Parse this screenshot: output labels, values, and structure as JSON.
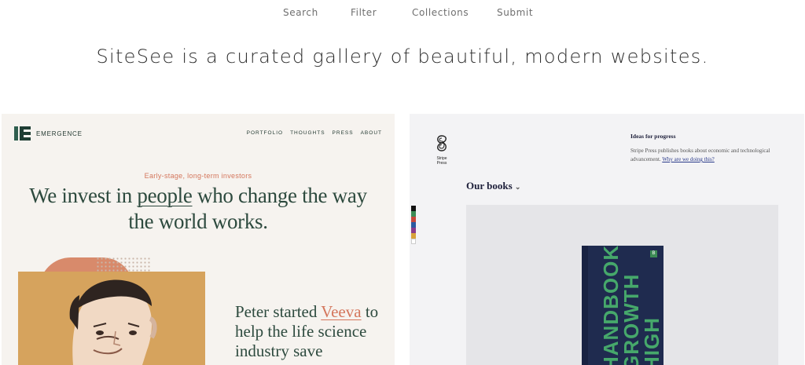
{
  "nav": {
    "items": [
      "Search",
      "Filter",
      "Collections",
      "Submit"
    ]
  },
  "tagline": "SiteSee is a curated gallery of beautiful, modern websites.",
  "emergence": {
    "logo_text": "EMERGENCE",
    "nav": [
      "PORTFOLIO",
      "THOUGHTS",
      "PRESS",
      "ABOUT"
    ],
    "eyebrow": "Early-stage, long-term investors",
    "headline_pre": "We invest in ",
    "headline_link": "people",
    "headline_post": " who change the way the world works.",
    "story_pre": "Peter started ",
    "story_link": "Veeva",
    "story_post": " to help the life science industry save",
    "colors": {
      "accent": "#d4765c",
      "green": "#2d4a3e",
      "bg": "#f6f3ef"
    }
  },
  "stripe_press": {
    "logo_text": "Stripe Press",
    "title": "Ideas for progress",
    "desc": "Stripe Press publishes books about economic and technological advancement.",
    "desc_link": "Why are we doing this?",
    "section_title": "Our books",
    "chevron": "⌄",
    "book_title_line1": "HIGH",
    "book_title_line2": "GROWTH",
    "book_title_line3": "HANDBOOK",
    "swatches": [
      "#111111",
      "#3c8b55",
      "#c7473a",
      "#2c5aa0",
      "#8a3c8b",
      "#d8a23a",
      "#ffffff"
    ],
    "colors": {
      "navy": "#1d1f3a",
      "book": "#1f2b4f",
      "book_text": "#46a86b"
    }
  }
}
